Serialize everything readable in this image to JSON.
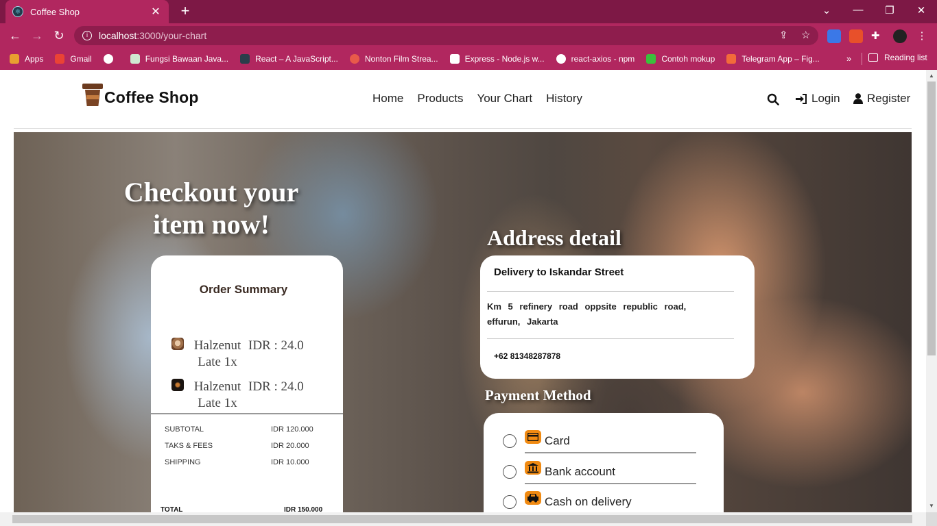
{
  "browser": {
    "tab_title": "Coffee Shop",
    "tab_close": "✕",
    "new_tab": "+",
    "url_host": "localhost",
    "url_path": ":3000/your-chart",
    "bookmarks": [
      {
        "label": "Apps",
        "color": "#e8a030"
      },
      {
        "label": "Gmail",
        "color": "#ea4335"
      },
      {
        "label": "",
        "color": "#ffffff"
      },
      {
        "label": "Fungsi Bawaan Java...",
        "color": "#d0e8d0"
      },
      {
        "label": "React – A JavaScript...",
        "color": "#2a3d4a"
      },
      {
        "label": "Nonton Film Strea...",
        "color": "#e85a4a"
      },
      {
        "label": "Express - Node.js w...",
        "color": "#ffffff"
      },
      {
        "label": "react-axios - npm",
        "color": "#ffffff"
      },
      {
        "label": "Contoh mokup",
        "color": "#3cbf3c"
      },
      {
        "label": "Telegram App – Fig...",
        "color": "#f26b3a"
      }
    ],
    "bookmarks_more": "»",
    "reading_list": "Reading list"
  },
  "header": {
    "brand": "Coffee Shop",
    "nav": [
      "Home",
      "Products",
      "Your Chart",
      "History"
    ],
    "login": "Login",
    "register": "Register"
  },
  "hero": {
    "title": "Checkout your item now!"
  },
  "order_summary": {
    "title": "Order Summary",
    "items": [
      {
        "name": "Halzenut Late 1x",
        "price": "IDR : 24.0",
        "thumb_color": "#a0704a"
      },
      {
        "name": "Halzenut Late 1x",
        "price": "IDR : 24.0",
        "thumb_color": "#1a1410"
      }
    ],
    "subtotal_label": "SUBTOTAL",
    "subtotal_value": "IDR 120.000",
    "tax_label": "TAKS & FEES",
    "tax_value": "IDR 20.000",
    "shipping_label": "SHIPPING",
    "shipping_value": "IDR 10.000",
    "total_label": "TOTAL",
    "total_value": "IDR 150.000"
  },
  "address": {
    "section_title": "Address detail",
    "recipient": "Delivery to Iskandar Street",
    "detail": "Km 5 refinery road oppsite republic road, effurun, Jakarta",
    "phone": "+62 81348287878"
  },
  "payment": {
    "section_title": "Payment Method",
    "options": [
      {
        "label": "Card",
        "icon": "card-icon"
      },
      {
        "label": "Bank account",
        "icon": "bank-icon"
      },
      {
        "label": "Cash on delivery",
        "icon": "car-icon"
      }
    ],
    "accent_color": "#f08a12"
  },
  "colors": {
    "browser_frame": "#7d1845",
    "browser_toolbar": "#b1275f"
  }
}
